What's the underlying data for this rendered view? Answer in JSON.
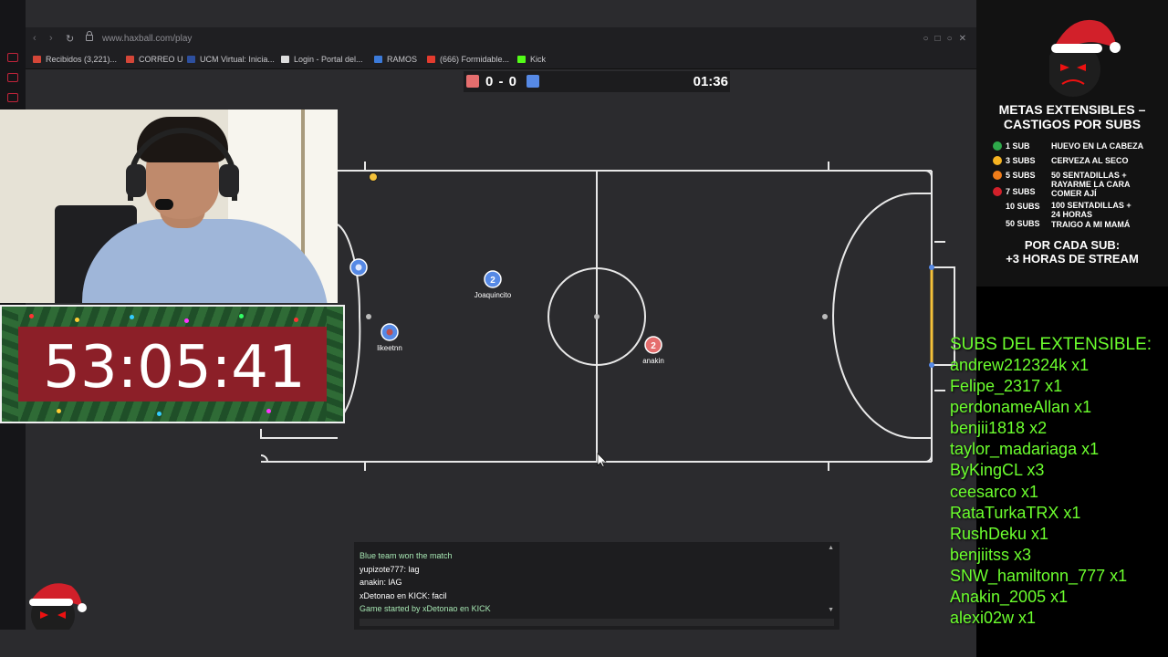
{
  "browser": {
    "url": "www.haxball.com/play",
    "bookmarks": [
      {
        "label": "Recibidos (3,221)...",
        "color": "#d44638"
      },
      {
        "label": "CORREO U",
        "color": "#d44638"
      },
      {
        "label": "UCM Virtual: Inicia...",
        "color": "#2d4f9e"
      },
      {
        "label": "Login - Portal del...",
        "color": "#dddddd"
      },
      {
        "label": "RAMOS",
        "color": "#3b7ad9"
      },
      {
        "label": "(666) Formidable...",
        "color": "#e33b2e"
      },
      {
        "label": "Kick",
        "color": "#53fc18"
      }
    ]
  },
  "scoreboard": {
    "score": "0 - 0",
    "clock": "01:36",
    "red_color": "#e56e6e",
    "blue_color": "#5689e5"
  },
  "players": [
    {
      "name": "Joaquincito",
      "number": "2",
      "team": "blue"
    },
    {
      "name": "anakin",
      "number": "2",
      "team": "red"
    },
    {
      "name": "likeetnn",
      "number": "",
      "team": "blue"
    },
    {
      "name": "",
      "number": "",
      "team": "blue"
    }
  ],
  "chat": {
    "lines": [
      {
        "text": "Blue team won the match",
        "system": true
      },
      {
        "text": "yupizote777: lag",
        "system": false
      },
      {
        "text": "anakin: lAG",
        "system": false
      },
      {
        "text": "xDetonao en KICK: facil",
        "system": false
      },
      {
        "text": "Game started by xDetonao en KICK",
        "system": true
      }
    ]
  },
  "stream_timer": "53:05:41",
  "overlay": {
    "title_line1": "METAS EXTENSIBLES –",
    "title_line2": "CASTIGOS POR SUBS",
    "rules": [
      {
        "subs": "1 SUB",
        "reward": "HUEVO EN LA CABEZA",
        "color": "#2ea84a"
      },
      {
        "subs": "3 SUBS",
        "reward": "CERVEZA AL SECO",
        "color": "#f5b321"
      },
      {
        "subs": "5 SUBS",
        "reward": "50 SENTADILLAS + RAYARME LA CARA",
        "color": "#f07d1a"
      },
      {
        "subs": "7 SUBS",
        "reward": "COMER AJÍ",
        "color": "#d2202a"
      },
      {
        "subs": "10 SUBS",
        "reward": "100 SENTADILLAS + 24 HORAS",
        "color": ""
      },
      {
        "subs": "50 SUBS",
        "reward": "TRAIGO A MI MAMÁ",
        "color": ""
      }
    ],
    "footer_line1": "POR CADA SUB:",
    "footer_line2": "+3 HORAS DE STREAM"
  },
  "subs": {
    "title": "SUBS DEL EXTENSIBLE:",
    "list": [
      "andrew212324k x1",
      "Felipe_2317 x1",
      "perdonameAllan x1",
      "benjii1818 x2",
      "taylor_madariaga x1",
      "ByKingCL x3",
      "ceesarco x1",
      "RataTurkaTRX x1",
      "RushDeku x1",
      "benjiitss x3",
      "SNW_hamiltonn_777 x1",
      "Anakin_2005 x1",
      "alexi02w x1"
    ]
  },
  "colors": {
    "pitch": "#2b2b2e",
    "lines": "#e8e8e8",
    "goal_post": "#f5c23a",
    "subs_green": "#6cff2e"
  }
}
